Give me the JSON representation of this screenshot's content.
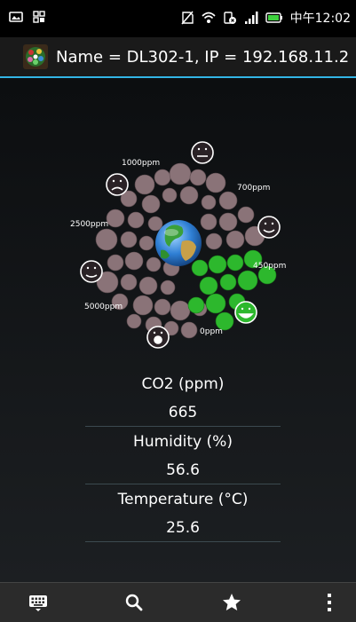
{
  "status_bar": {
    "network_label": "中午",
    "time": "12:02"
  },
  "action_bar": {
    "title": "Name = DL302-1, IP = 192.168.11.2",
    "accent_color": "#33b5e5"
  },
  "co2_gauge": {
    "labels": {
      "ppm_1000": "1000ppm",
      "ppm_700": "700ppm",
      "ppm_2500": "2500ppm",
      "ppm_450": "450ppm",
      "ppm_5000": "5000ppm",
      "ppm_0": "0ppm"
    },
    "active_color": "#2db82d",
    "inactive_color": "#8a7378"
  },
  "readings": {
    "co2_label": "CO2 (ppm)",
    "co2_value": "665",
    "humidity_label": "Humidity (%)",
    "humidity_value": "56.6",
    "temperature_label": "Temperature (°C)",
    "temperature_value": "25.6"
  },
  "bottom_bar": {
    "icons": [
      "keyboard-icon",
      "search-icon",
      "star-icon",
      "overflow-menu-icon"
    ]
  }
}
